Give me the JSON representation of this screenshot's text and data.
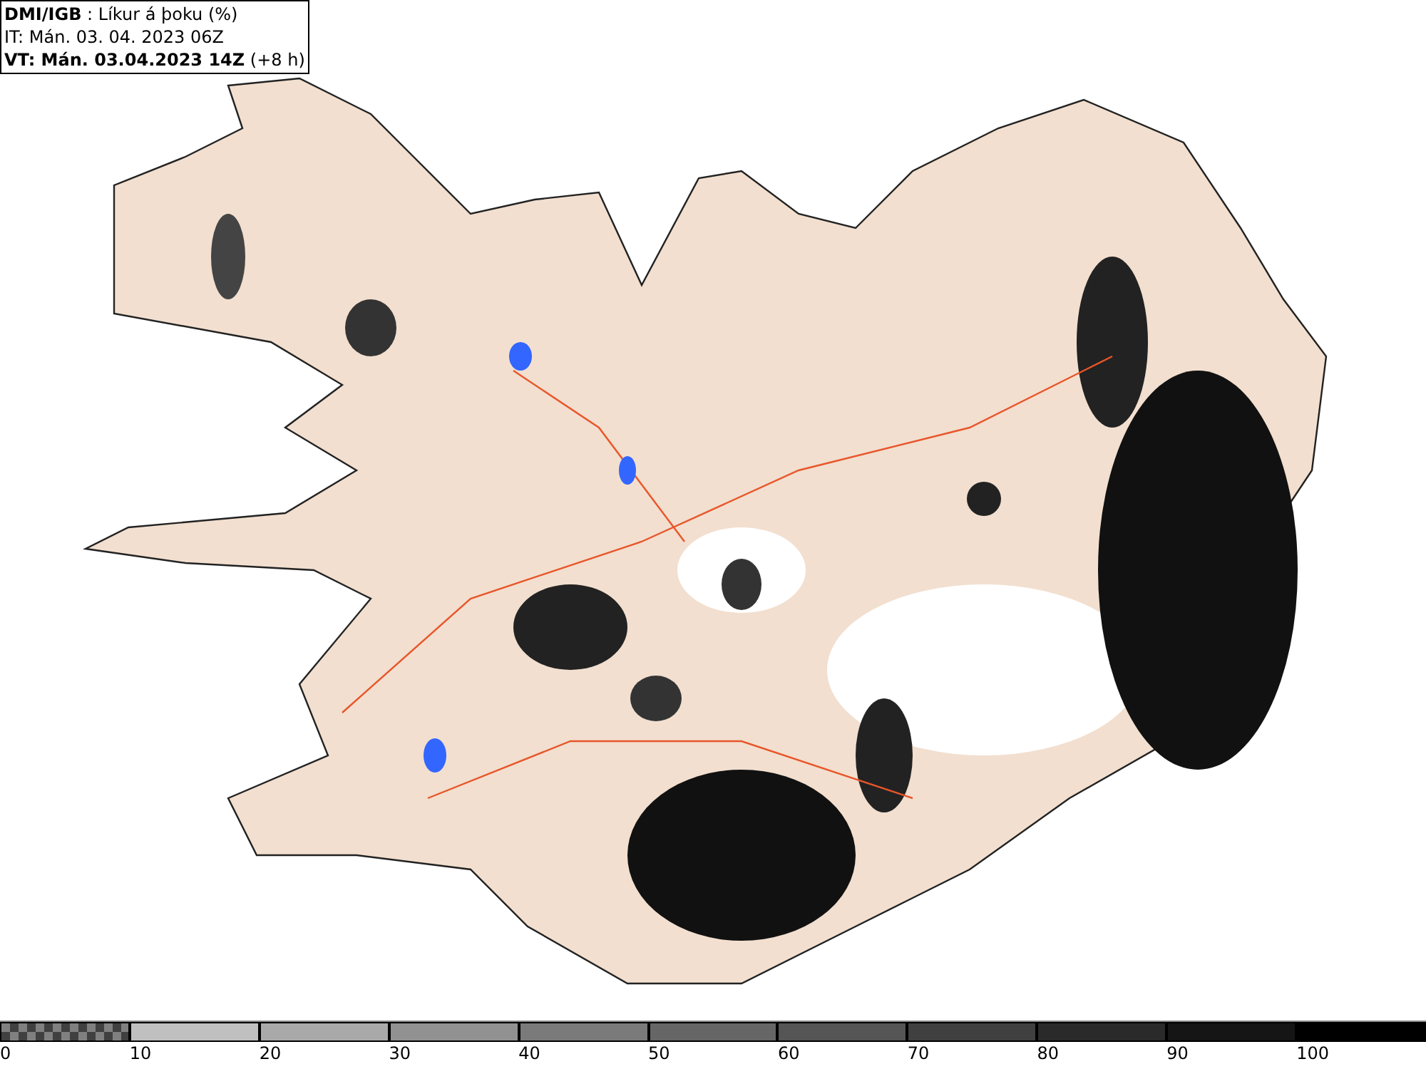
{
  "info_box": {
    "lines": [
      "**DMI/IGB** : Líkur á þoku (%)",
      "IT: Mán. 03. 04. 2023 06Z",
      "**VT: Mán. 03.04.2023 14Z** (+8 h)"
    ]
  },
  "legend": [
    {
      "label": "0",
      "kind": "checkered",
      "color": "#808080"
    },
    {
      "label": "10",
      "kind": "solid",
      "color": "#c0c0c0"
    },
    {
      "label": "20",
      "kind": "solid",
      "color": "#a9a9a9"
    },
    {
      "label": "30",
      "kind": "solid",
      "color": "#919191"
    },
    {
      "label": "40",
      "kind": "solid",
      "color": "#7a7a7a"
    },
    {
      "label": "50",
      "kind": "solid",
      "color": "#666666"
    },
    {
      "label": "60",
      "kind": "solid",
      "color": "#555555"
    },
    {
      "label": "70",
      "kind": "solid",
      "color": "#404040"
    },
    {
      "label": "80",
      "kind": "solid",
      "color": "#2a2a2a"
    },
    {
      "label": "90",
      "kind": "solid",
      "color": "#151515"
    },
    {
      "label": "100",
      "kind": "solid",
      "color": "#000000"
    }
  ]
}
